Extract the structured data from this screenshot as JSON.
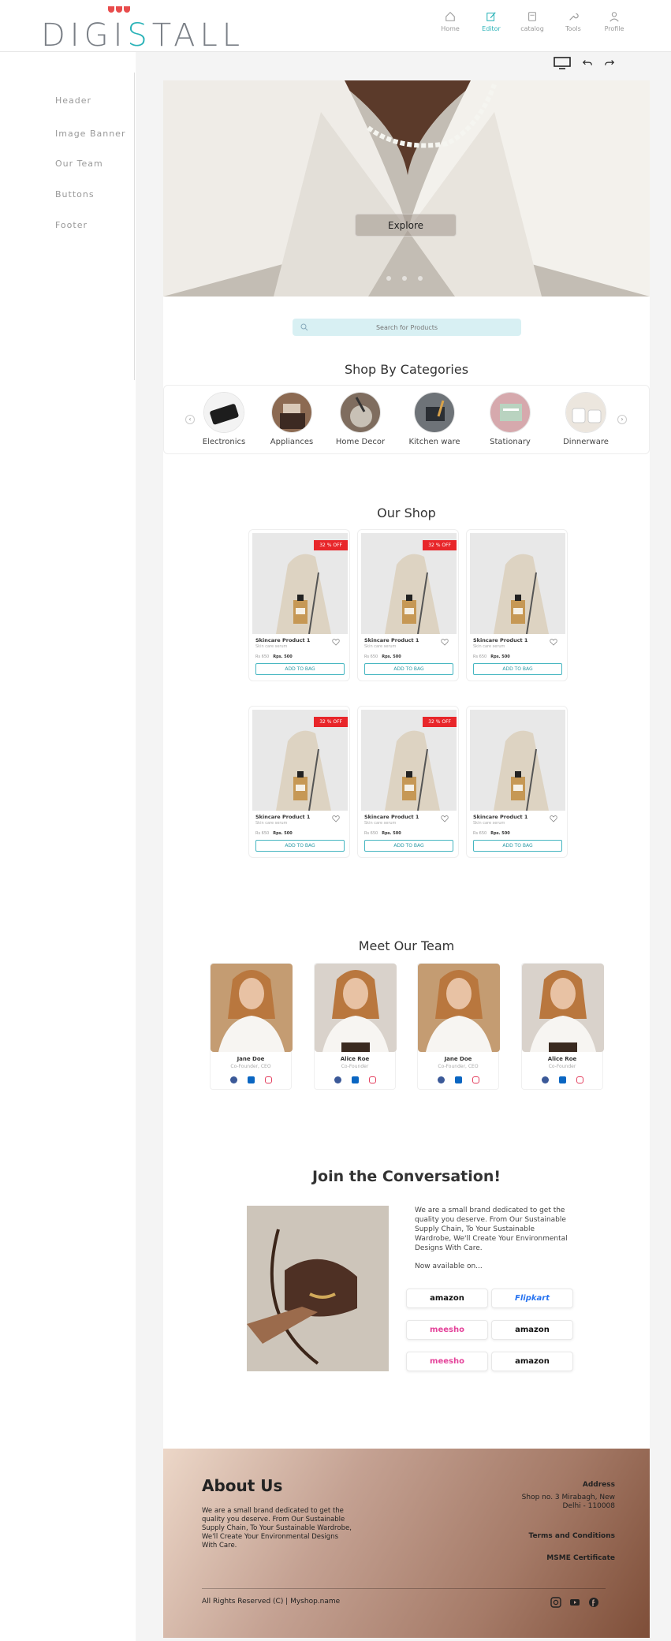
{
  "brand": {
    "logo_text_a": "DIGI",
    "logo_text_s": "S",
    "logo_text_b": "TALL"
  },
  "nav": [
    {
      "label": "Home",
      "icon": "home-icon"
    },
    {
      "label": "Editor",
      "icon": "edit-icon",
      "active": true
    },
    {
      "label": "catalog",
      "icon": "catalog-icon"
    },
    {
      "label": "Tools",
      "icon": "wrench-icon"
    },
    {
      "label": "Profile",
      "icon": "user-icon"
    }
  ],
  "sidebar": {
    "items": [
      "Header",
      "Image Banner",
      "Our Team",
      "Buttons",
      "Footer"
    ]
  },
  "hero": {
    "button_label": "Explore",
    "slides": 3
  },
  "search": {
    "placeholder": "Search for Products"
  },
  "categories": {
    "title": "Shop By Categories",
    "items": [
      "Electronics",
      "Appliances",
      "Home Decor",
      "Kitchen ware",
      "Stationary",
      "Dinnerware"
    ]
  },
  "shop": {
    "title": "Our Shop",
    "products": [
      {
        "name": "Skincare Product 1",
        "sub": "Skin care serum",
        "old_price": "Rs 650",
        "price": "Rps. 500",
        "badge": "32 % OFF",
        "button": "ADD TO BAG"
      },
      {
        "name": "Skincare Product 1",
        "sub": "Skin care serum",
        "old_price": "Rs 650",
        "price": "Rps. 500",
        "badge": "32 % OFF",
        "button": "ADD TO BAG"
      },
      {
        "name": "Skincare Product 1",
        "sub": "Skin care serum",
        "old_price": "Rs 650",
        "price": "Rps. 500",
        "badge": "",
        "button": "ADD TO BAG"
      },
      {
        "name": "Skincare Product 1",
        "sub": "Skin care serum",
        "old_price": "Rs 650",
        "price": "Rps. 500",
        "badge": "32 % OFF",
        "button": "ADD TO BAG"
      },
      {
        "name": "Skincare Product 1",
        "sub": "Skin care serum",
        "old_price": "Rs 650",
        "price": "Rps. 500",
        "badge": "32 % OFF",
        "button": "ADD TO BAG"
      },
      {
        "name": "Skincare Product 1",
        "sub": "Skin care serum",
        "old_price": "Rs 650",
        "price": "Rps. 500",
        "badge": "",
        "button": "ADD TO BAG"
      }
    ]
  },
  "team": {
    "title": "Meet Our Team",
    "members": [
      {
        "name": "Jane Doe",
        "role": "Co-Founder, CEO"
      },
      {
        "name": "Alice Roe",
        "role": "Co-Founder"
      },
      {
        "name": "Jane Doe",
        "role": "Co-Founder, CEO"
      },
      {
        "name": "Alice Roe",
        "role": "Co-Founder"
      }
    ]
  },
  "join": {
    "title": "Join the Conversation!",
    "text": "We are a small brand dedicated to get the quality you deserve. From Our Sustainable Supply Chain, To Your Sustainable Wardrobe, We'll Create Your Environmental Designs With Care.",
    "available": "Now available on...",
    "stores": [
      "amazon",
      "Flipkart",
      "meesho",
      "amazon",
      "meesho",
      "amazon"
    ]
  },
  "footer": {
    "about_title": "About Us",
    "about_text": "We are a small brand dedicated to get the quality you deserve. From Our Sustainable Supply Chain, To Your Sustainable Wardrobe, We'll Create Your Environmental Designs With Care.",
    "address_title": "Address",
    "address": "Shop no. 3 Mirabagh, New Delhi - 110008",
    "terms": "Terms and Conditions",
    "msme": "MSME Certificate",
    "copyright": "All Rights Reserved (C) | Myshop.name"
  },
  "colors": {
    "accent": "#2bb3b8",
    "badge": "#e8262a",
    "meesho": "#e4439a",
    "flipkart": "#2874f0"
  }
}
